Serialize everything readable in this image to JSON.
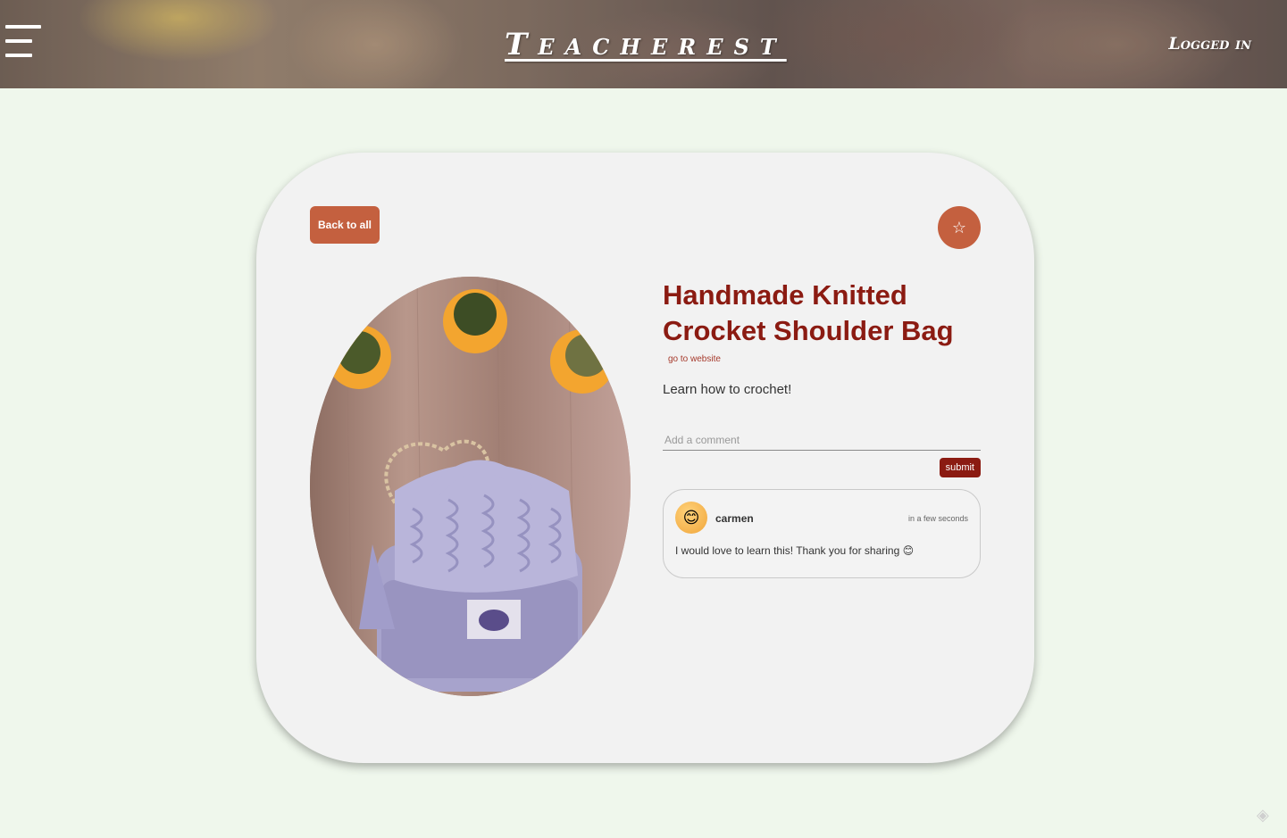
{
  "header": {
    "menu_icon": "hamburger-menu-icon",
    "brand": "Teacherest",
    "status": "Logged in"
  },
  "card": {
    "back_label": "Back to all",
    "favorite_icon": "☆",
    "title": "Handmade Knitted Crocket Shoulder Bag",
    "website_link": "go to website",
    "description": "Learn how to crochet!",
    "comment_placeholder": "Add a comment",
    "submit_label": "submit",
    "comments": [
      {
        "avatar_emoji": "😊",
        "author": "carmen",
        "time": "in a few seconds",
        "text": "I would love to learn this! Thank you for sharing 😊"
      }
    ]
  },
  "colors": {
    "accent": "#c4603f",
    "title": "#8b1b12",
    "background": "#eff7ec",
    "card": "#f2f2f2"
  }
}
